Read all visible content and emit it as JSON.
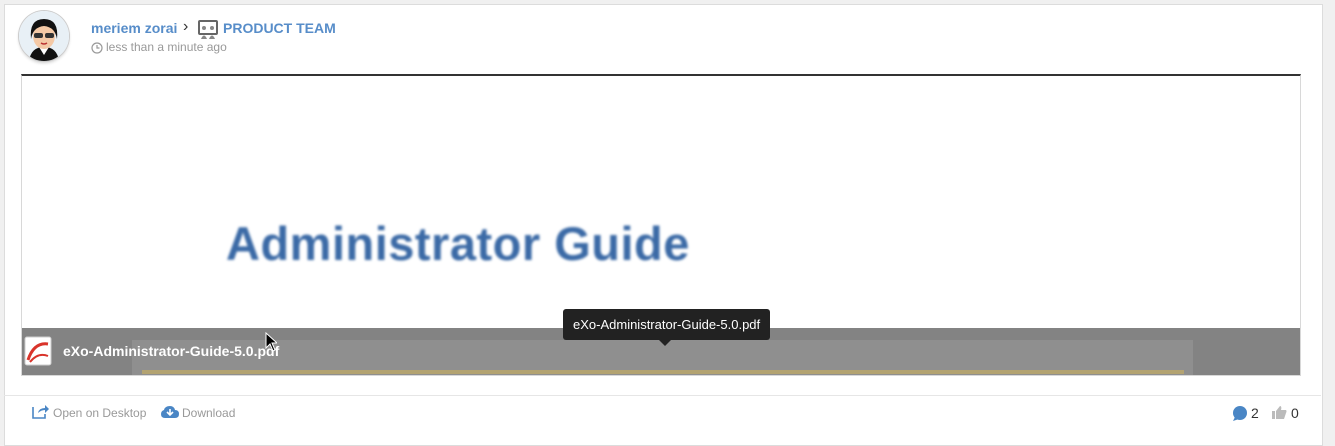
{
  "post": {
    "author": "meriem zorai",
    "separator": "›",
    "space": "PRODUCT TEAM",
    "time": "less than a minute ago"
  },
  "preview": {
    "document_heading": "Administrator Guide",
    "file_name": "eXo-Administrator-Guide-5.0.pdf",
    "tooltip": "eXo-Administrator-Guide-5.0.pdf"
  },
  "actions": {
    "open_desktop": "Open on Desktop",
    "download": "Download",
    "comments": "2",
    "likes": "0"
  },
  "icons": {
    "space": "space-icon",
    "clock": "clock-icon",
    "pdf": "pdf-icon",
    "open": "open-on-desktop-icon",
    "download": "cloud-download-icon",
    "comment": "comment-icon",
    "like": "thumbs-up-icon"
  },
  "colors": {
    "link": "#578dc9",
    "doc_heading": "#3b6aa6",
    "icon_blue": "#4a86c5"
  }
}
